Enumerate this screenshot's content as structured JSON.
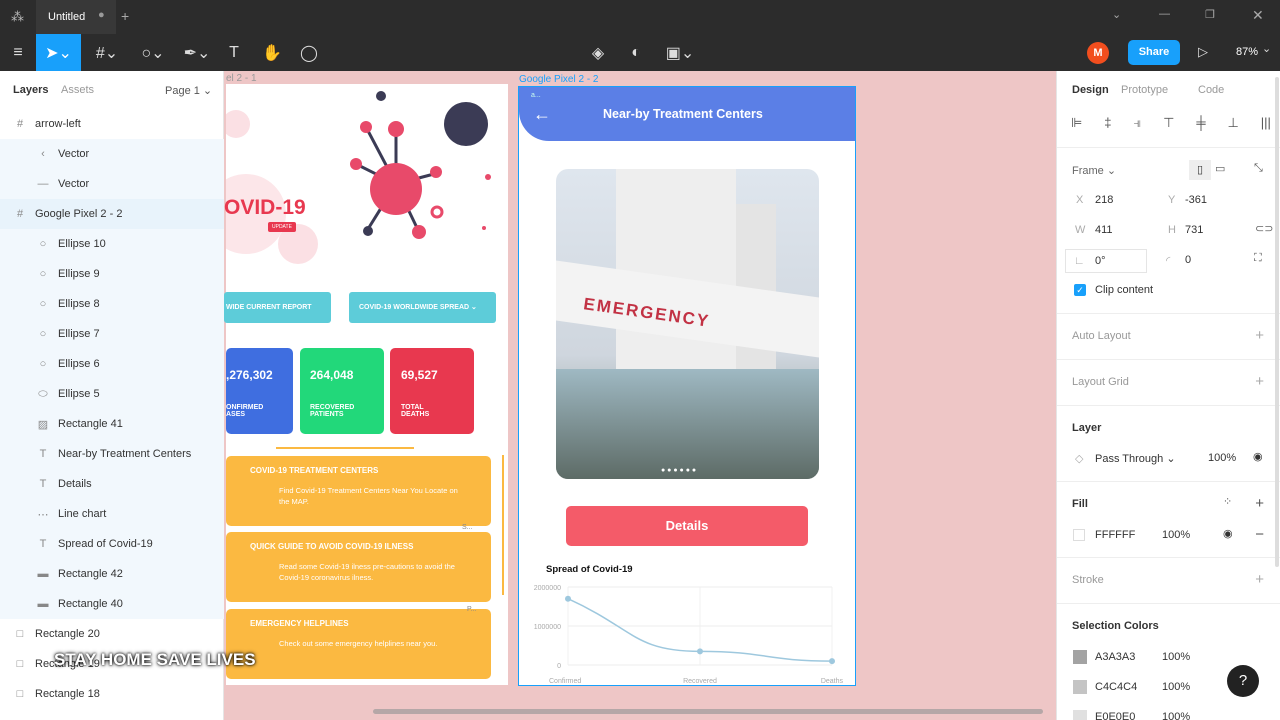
{
  "tab": {
    "title": "Untitled",
    "add": "+"
  },
  "toolbar": {
    "share": "Share",
    "zoom": "87%",
    "avatar": "M"
  },
  "left": {
    "tabs": [
      "Layers",
      "Assets"
    ],
    "page": "Page 1",
    "layers": [
      {
        "name": "arrow-left",
        "icon": "#",
        "depth": 0
      },
      {
        "name": "Vector",
        "icon": "‹",
        "depth": 1
      },
      {
        "name": "Vector",
        "icon": "—",
        "depth": 1
      },
      {
        "name": "Google Pixel 2 - 2",
        "icon": "#",
        "depth": 0,
        "sel": true
      },
      {
        "name": "Ellipse 10",
        "icon": "○",
        "depth": 1
      },
      {
        "name": "Ellipse 9",
        "icon": "○",
        "depth": 1
      },
      {
        "name": "Ellipse 8",
        "icon": "○",
        "depth": 1
      },
      {
        "name": "Ellipse 7",
        "icon": "○",
        "depth": 1
      },
      {
        "name": "Ellipse 6",
        "icon": "○",
        "depth": 1
      },
      {
        "name": "Ellipse 5",
        "icon": "⬭",
        "depth": 1
      },
      {
        "name": "Rectangle 41",
        "icon": "▨",
        "depth": 1
      },
      {
        "name": "Near-by Treatment Centers",
        "icon": "T",
        "depth": 1
      },
      {
        "name": "Details",
        "icon": "T",
        "depth": 1
      },
      {
        "name": "Line chart",
        "icon": "⋯",
        "depth": 1
      },
      {
        "name": "Spread of Covid-19",
        "icon": "T",
        "depth": 1
      },
      {
        "name": "Rectangle 42",
        "icon": "▬",
        "depth": 1
      },
      {
        "name": "Rectangle 40",
        "icon": "▬",
        "depth": 1
      },
      {
        "name": "Rectangle 20",
        "icon": "□",
        "depth": 0
      },
      {
        "name": "Rectangle 19",
        "icon": "□",
        "depth": 0
      },
      {
        "name": "Rectangle 18",
        "icon": "□",
        "depth": 0
      }
    ]
  },
  "overlay": "STAY HOME SAVE LIVES",
  "canvas": {
    "frame1_label": "el 2 - 1",
    "frame2_label": "Google Pixel 2 - 2",
    "covid_title": "OVID-19",
    "update": "UPDATE",
    "btn1": "WIDE CURRENT REPORT",
    "btn2": "COVID-19 WORLDWIDE SPREAD",
    "stats": [
      {
        "num": ",276,302",
        "label": "ONFIRMED\nASES",
        "color": "#3f6ee0"
      },
      {
        "num": "264,048",
        "label": "RECOVERED\nPATIENTS",
        "color": "#22d87a"
      },
      {
        "num": "69,527",
        "label": "TOTAL\nDEATHS",
        "color": "#e8384f"
      }
    ],
    "cards": [
      {
        "title": "COVID-19 TREATMENT CENTERS",
        "desc": "Find Covid-19 Treatment Centers Near You Locate on the MAP."
      },
      {
        "title": "QUICK GUIDE TO AVOID COVID-19 ILNESS",
        "desc": "Read some Covid-19 ilness pre-cautions to avoid the Covid-19 coronavirus ilness."
      },
      {
        "title": "EMERGENCY HELPLINES",
        "desc": "Check out some emergency helplines near you."
      }
    ],
    "s_label": "S...",
    "p_label": "P...",
    "header_title": "Near-by Treatment Centers",
    "header_small": "a...",
    "emergency": "EMERGENCY",
    "details": "Details"
  },
  "chart_data": {
    "type": "line",
    "title": "Spread of Covid-19",
    "categories": [
      "Confirmed",
      "Recovered",
      "Deaths"
    ],
    "values": [
      1700000,
      350000,
      100000
    ],
    "yticks": [
      "2000000",
      "1000000",
      "0"
    ],
    "ylim": [
      0,
      2000000
    ],
    "grid": true,
    "color": "#9ec8de"
  },
  "right": {
    "tabs": [
      "Design",
      "Prototype",
      "Code"
    ],
    "frame": "Frame",
    "x": "218",
    "y": "-361",
    "w": "411",
    "h": "731",
    "rotation": "0°",
    "radius": "0",
    "clip": "Clip content",
    "auto_layout": "Auto Layout",
    "layout_grid": "Layout Grid",
    "layer": "Layer",
    "blend": "Pass Through",
    "opacity": "100%",
    "fill": "Fill",
    "fill_hex": "FFFFFF",
    "fill_op": "100%",
    "stroke": "Stroke",
    "selection_colors": "Selection Colors",
    "colors": [
      {
        "hex": "A3A3A3",
        "op": "100%"
      },
      {
        "hex": "C4C4C4",
        "op": "100%"
      },
      {
        "hex": "E0E0E0",
        "op": "100%"
      }
    ]
  },
  "help": "?"
}
